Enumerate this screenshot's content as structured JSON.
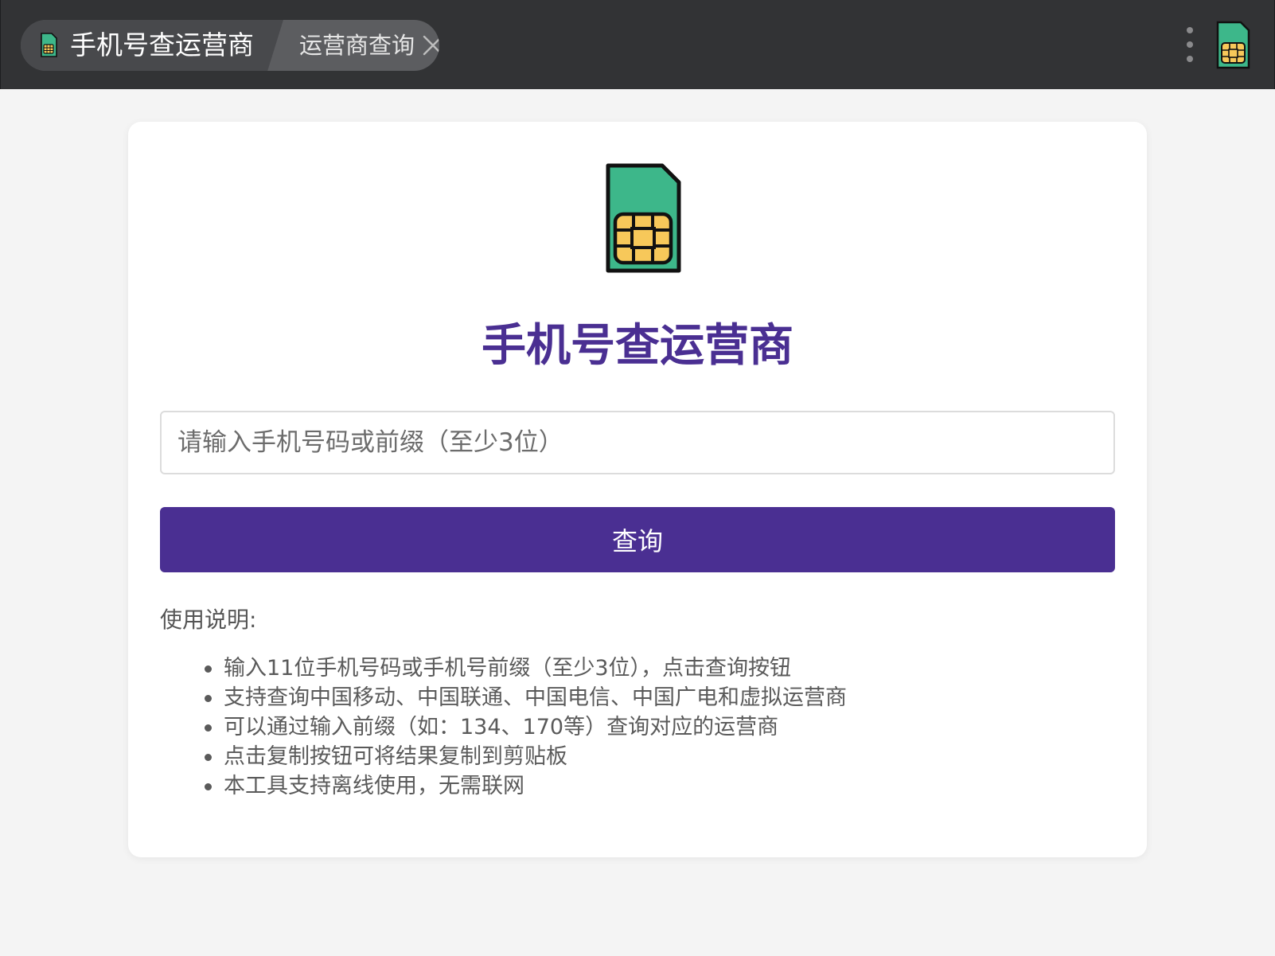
{
  "titlebar": {
    "app_title": "手机号查运营商",
    "page_title": "运营商查询",
    "app_icon": "sim-card-icon",
    "close_icon": "close-icon",
    "more_icon": "more-vertical-icon"
  },
  "main": {
    "hero_icon": "sim-card-icon",
    "title": "手机号查运营商",
    "search": {
      "placeholder": "请输入手机号码或前缀（至少3位）",
      "value": ""
    },
    "query_button_label": "查询",
    "usage": {
      "title": "使用说明:",
      "items": [
        "输入11位手机号码或手机号前缀（至少3位），点击查询按钮",
        "支持查询中国移动、中国联通、中国电信、中国广电和虚拟运营商",
        "可以通过输入前缀（如：134、170等）查询对应的运营商",
        "点击复制按钮可将结果复制到剪贴板",
        "本工具支持离线使用，无需联网"
      ]
    }
  },
  "colors": {
    "accent": "#4a2f92",
    "topbar": "#323335",
    "sim_green": "#3db78a",
    "sim_chip": "#f7c85a"
  }
}
